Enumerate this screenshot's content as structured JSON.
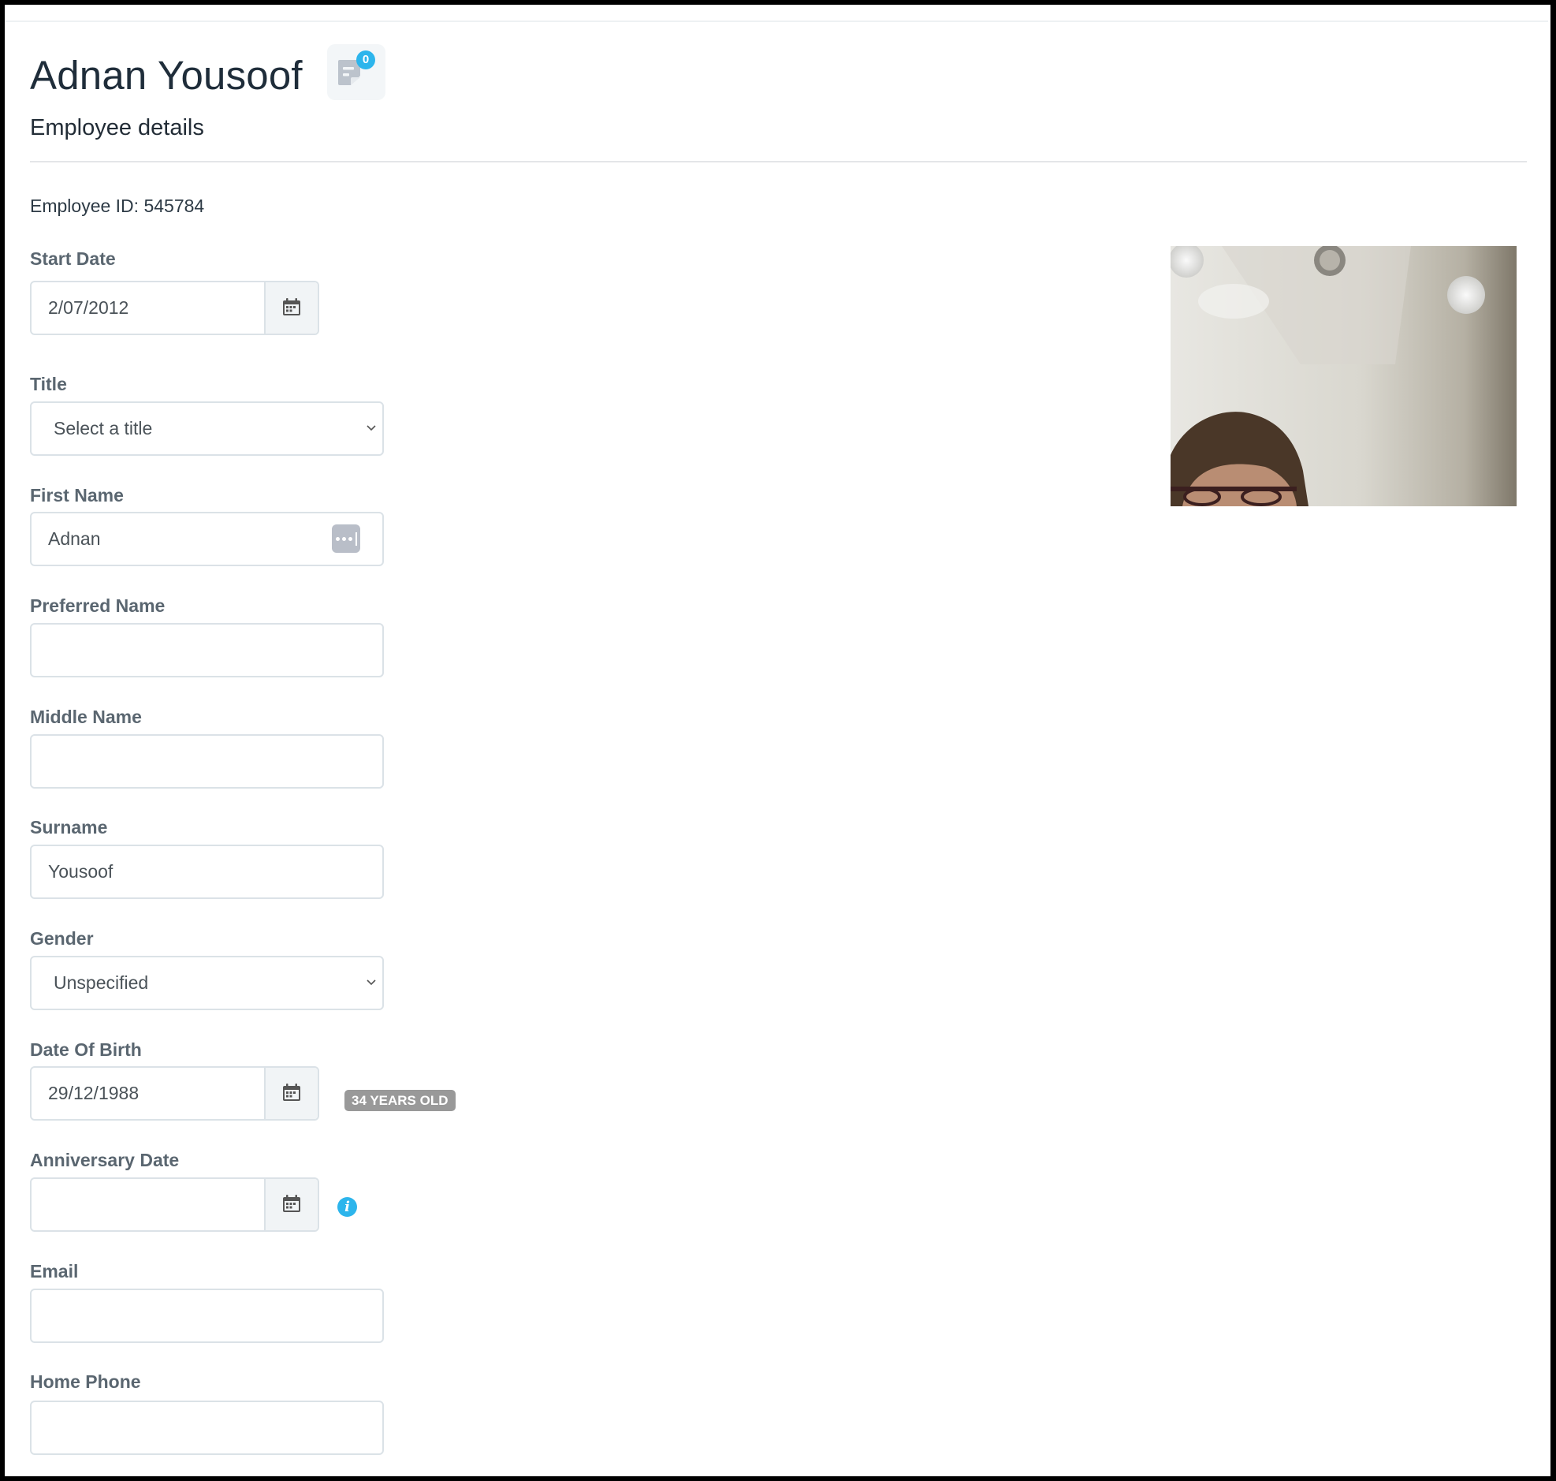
{
  "header": {
    "name": "Adnan Yousoof",
    "notes_count": "0",
    "subtitle": "Employee details",
    "employee_id": "Employee ID: 545784"
  },
  "icons": {
    "notes": "notes-icon",
    "calendar": "calendar-icon",
    "chevron": "chevron-down-icon",
    "autofill": "password-autofill-icon",
    "info": "info-icon"
  },
  "colors": {
    "accent": "#2db5ec",
    "heading": "#1f2d3a",
    "label": "#5a6670",
    "badge": "#999999"
  },
  "form": {
    "start_date": {
      "label": "Start Date",
      "value": "2/07/2012"
    },
    "title": {
      "label": "Title",
      "value": "Select a title"
    },
    "first_name": {
      "label": "First Name",
      "value": "Adnan"
    },
    "preferred_name": {
      "label": "Preferred Name",
      "value": ""
    },
    "middle_name": {
      "label": "Middle Name",
      "value": ""
    },
    "surname": {
      "label": "Surname",
      "value": "Yousoof"
    },
    "gender": {
      "label": "Gender",
      "value": "Unspecified"
    },
    "date_of_birth": {
      "label": "Date Of Birth",
      "value": "29/12/1988",
      "age_badge": "34 YEARS OLD"
    },
    "anniversary_date": {
      "label": "Anniversary Date",
      "value": "",
      "info": "i"
    },
    "email": {
      "label": "Email",
      "value": ""
    },
    "home_phone": {
      "label": "Home Phone",
      "value": ""
    }
  },
  "photo": {
    "alt": "Employee photo"
  }
}
